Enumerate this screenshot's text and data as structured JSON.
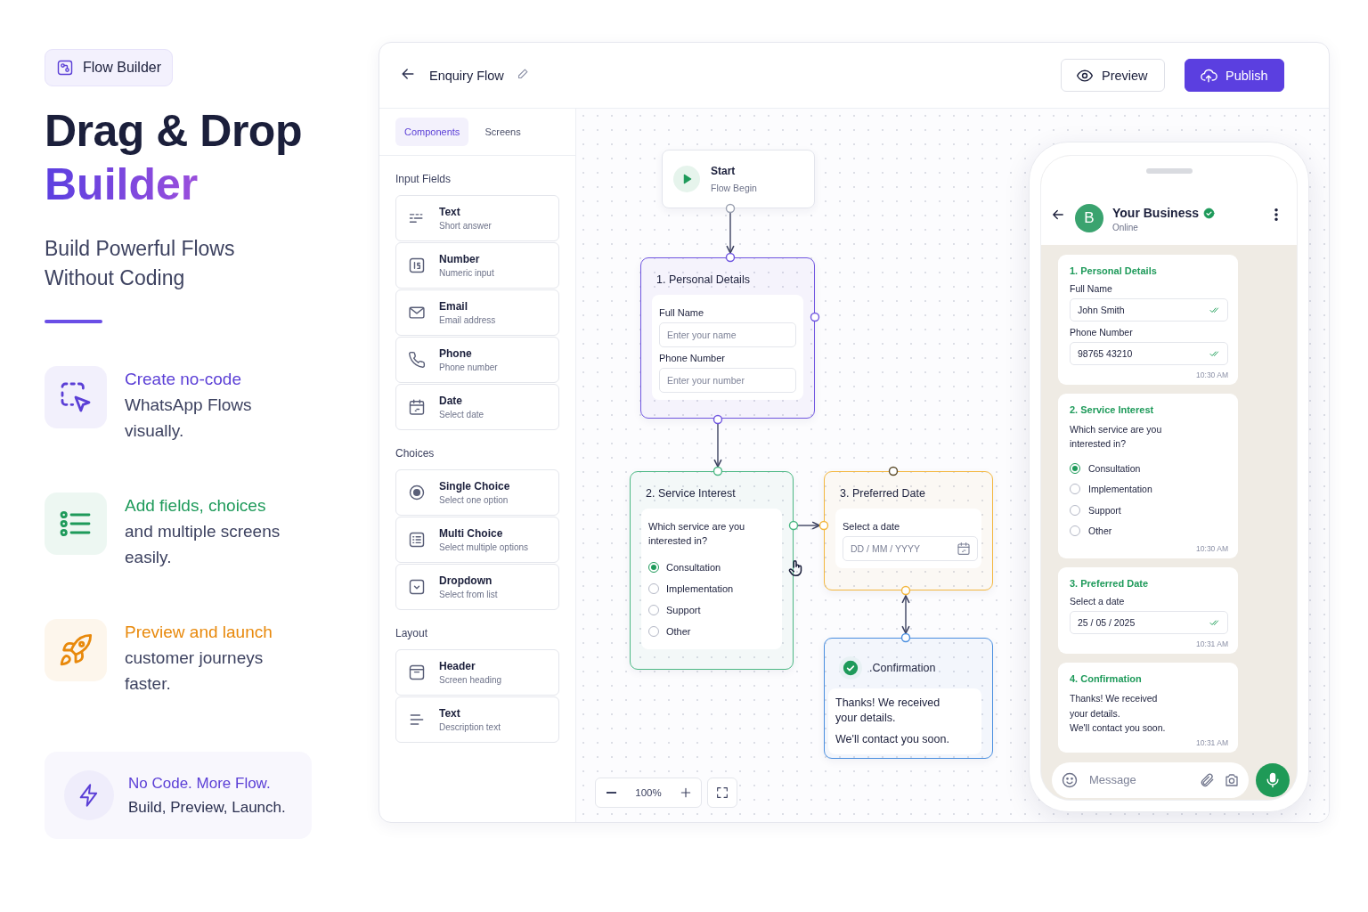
{
  "badge": {
    "label": "Flow Builder"
  },
  "headline": {
    "line1": "Drag & Drop",
    "line2": "Builder"
  },
  "subtitle": [
    "Build Powerful Flows",
    "Without Coding"
  ],
  "features": [
    {
      "kind": "select",
      "color": "#5b3fd6",
      "title": "Create no-code",
      "text": "WhatsApp Flows visually."
    },
    {
      "kind": "list",
      "color": "#1e9a5a",
      "title": "Add fields, choices",
      "text": "and multiple screens easily."
    },
    {
      "kind": "rocket",
      "color": "#e8890c",
      "title": "Preview and launch",
      "text": "customer journeys faster."
    }
  ],
  "callout": {
    "title": "No Code. More Flow.",
    "text": "Build, Preview, Launch."
  },
  "app": {
    "title": "Enquiry Flow",
    "buttons": [
      {
        "kind": "secondary",
        "label": "Preview"
      },
      {
        "kind": "primary",
        "label": "Publish"
      }
    ],
    "tabs": [
      {
        "label": "Components",
        "selected": true
      },
      {
        "label": "Screens",
        "selected": false
      }
    ],
    "sections": [
      {
        "title": "Input Fields",
        "items": [
          {
            "kind": "text",
            "name": "Text",
            "description": "Short answer"
          },
          {
            "kind": "number",
            "name": "Number",
            "description": "Numeric input"
          },
          {
            "kind": "email",
            "name": "Email",
            "description": "Email address"
          },
          {
            "kind": "phone",
            "name": "Phone",
            "description": "Phone number"
          },
          {
            "kind": "date",
            "name": "Date",
            "description": "Select date"
          }
        ]
      },
      {
        "title": "Choices",
        "items": [
          {
            "kind": "single",
            "name": "Single Choice",
            "description": "Select one option"
          },
          {
            "kind": "multi",
            "name": "Multi Choice",
            "description": "Select multiple options"
          },
          {
            "kind": "dropdown",
            "name": "Dropdown",
            "description": "Select from list"
          }
        ]
      },
      {
        "title": "Layout",
        "items": [
          {
            "kind": "header",
            "name": "Header",
            "description": "Screen heading"
          },
          {
            "kind": "paragraph",
            "name": "Text",
            "description": "Description text"
          }
        ]
      }
    ],
    "start_node": {
      "title": "Start",
      "subtitle": "Flow Begin"
    },
    "nodes": [
      {
        "kind": "form",
        "color": "#7056e0",
        "title": "1. Personal Details",
        "fields": [
          {
            "label": "Full Name",
            "placeholder": "Enter your name"
          },
          {
            "label": "Phone Number",
            "placeholder": "Enter your number"
          }
        ]
      },
      {
        "kind": "choice",
        "color": "#4cb884",
        "title": "2. Service Interest",
        "question": "Which service are you interested in?",
        "options": [
          {
            "label": "Consultation",
            "selected": true
          },
          {
            "label": "Implementation",
            "selected": false
          },
          {
            "label": "Support",
            "selected": false
          },
          {
            "label": "Other",
            "selected": false
          }
        ]
      },
      {
        "kind": "date",
        "color": "#f3b73f",
        "title": "3. Preferred Date",
        "label": "Select a date",
        "placeholder": "DD / MM / YYYY"
      },
      {
        "kind": "confirm",
        "color": "#4a8fe0",
        "title": ".Confirmation",
        "paragraphs": [
          "Thanks! We received your details.",
          "We'll contact you soon."
        ]
      }
    ],
    "zoom": "100%",
    "phone": {
      "initial": "B",
      "name": "Your Business",
      "status": "Online",
      "messages": [
        {
          "kind": "form",
          "title": "1. Personal Details",
          "fields": [
            {
              "label": "Full Name",
              "value": "John Smith"
            },
            {
              "label": "Phone Number",
              "value": "98765 43210"
            }
          ],
          "time": "10:30 AM"
        },
        {
          "kind": "choice",
          "title": "2. Service Interest",
          "question": "Which service are you interested in?",
          "options": [
            {
              "label": "Consultation",
              "selected": true
            },
            {
              "label": "Implementation",
              "selected": false
            },
            {
              "label": "Support",
              "selected": false
            },
            {
              "label": "Other",
              "selected": false
            }
          ],
          "time": "10:30 AM"
        },
        {
          "kind": "date",
          "title": "3. Preferred Date",
          "label": "Select a date",
          "value": "25 / 05 / 2025",
          "time": "10:31 AM"
        },
        {
          "kind": "text",
          "title": "4. Confirmation",
          "lines": [
            "Thanks! We received your details.",
            "We'll contact you soon."
          ],
          "time": "10:31 AM"
        }
      ],
      "placeholder": "Message"
    }
  }
}
